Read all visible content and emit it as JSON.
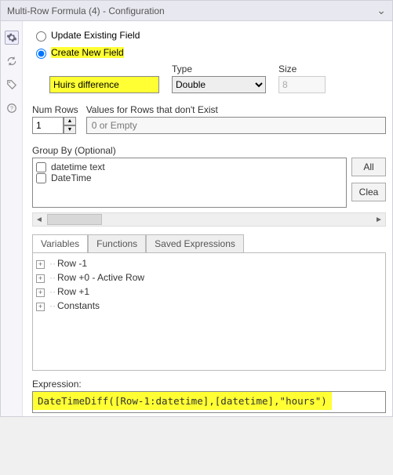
{
  "titlebar": {
    "title": "Multi-Row Formula (4) - Configuration"
  },
  "radios": {
    "update_label": "Update Existing Field",
    "create_label": "Create New  Field"
  },
  "new_field": {
    "name_value": "Huirs difference",
    "type_label": "Type",
    "type_value": "Double",
    "size_label": "Size",
    "size_value": "8"
  },
  "numrows": {
    "label": "Num Rows",
    "value": "1",
    "vals_label": "Values for Rows that don't Exist",
    "vals_value": "0 or Empty"
  },
  "groupby": {
    "label": "Group By (Optional)",
    "items": [
      "datetime text",
      "DateTime"
    ],
    "all_btn": "All",
    "clear_btn": "Clea"
  },
  "tabs": {
    "variables": "Variables",
    "functions": "Functions",
    "saved": "Saved Expressions"
  },
  "tree": {
    "items": [
      "Row -1",
      "Row +0 - Active Row",
      "Row +1",
      "Constants"
    ]
  },
  "expression": {
    "label": "Expression:",
    "value": "DateTimeDiff([Row-1:datetime],[datetime],\"hours\")"
  }
}
